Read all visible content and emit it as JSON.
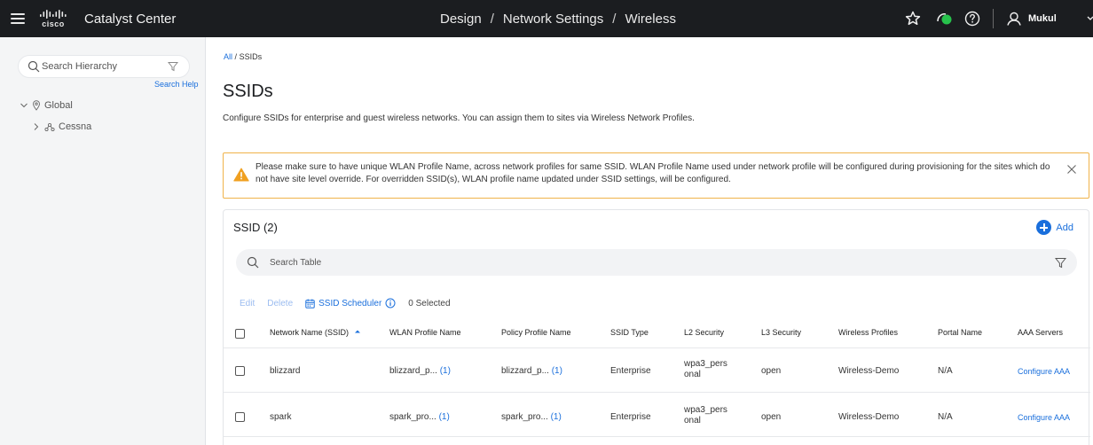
{
  "topbar": {
    "logo_text": "cisco",
    "app_name": "Catalyst Center",
    "breadcrumb": [
      "Design",
      "Network Settings",
      "Wireless"
    ],
    "user_name": "Mukul"
  },
  "sidebar": {
    "search_placeholder": "Search Hierarchy",
    "search_help": "Search Help",
    "tree": [
      {
        "label": "Global"
      },
      {
        "label": "Cessna"
      }
    ]
  },
  "main": {
    "breadcrumb_all": "All",
    "breadcrumb_sep": "/",
    "breadcrumb_current": "SSIDs",
    "title": "SSIDs",
    "description": "Configure SSIDs for enterprise and guest wireless networks. You can assign them to sites via Wireless Network Profiles.",
    "alert_text": "Please make sure to have unique WLAN Profile Name, across network profiles for same SSID. WLAN Profile Name used under network profile will be configured during provisioning for the sites which do not have site level override. For overridden SSID(s), WLAN profile name updated under SSID settings, will be configured."
  },
  "card": {
    "title": "SSID (2)",
    "add_label": "Add",
    "search_placeholder": "Search Table",
    "actions": {
      "edit": "Edit",
      "delete": "Delete",
      "scheduler": "SSID Scheduler",
      "selected": "0 Selected"
    },
    "columns": [
      "Network Name (SSID)",
      "WLAN Profile Name",
      "Policy Profile Name",
      "SSID Type",
      "L2 Security",
      "L3 Security",
      "Wireless Profiles",
      "Portal Name",
      "AAA Servers"
    ],
    "rows": [
      {
        "ssid": "blizzard",
        "wlan_profile": "blizzard_p...",
        "wlan_count": "(1)",
        "policy_profile": "blizzard_p...",
        "policy_count": "(1)",
        "ssid_type": "Enterprise",
        "l2_line1": "wpa3_pers",
        "l2_line2": "onal",
        "l3": "open",
        "wireless_profiles": "Wireless-Demo",
        "portal": "N/A",
        "aaa": "Configure AAA"
      },
      {
        "ssid": "spark",
        "wlan_profile": "spark_pro...",
        "wlan_count": "(1)",
        "policy_profile": "spark_pro...",
        "policy_count": "(1)",
        "ssid_type": "Enterprise",
        "l2_line1": "wpa3_pers",
        "l2_line2": "onal",
        "l3": "open",
        "wireless_profiles": "Wireless-Demo",
        "portal": "N/A",
        "aaa": "Configure AAA"
      }
    ]
  },
  "colors": {
    "topbar_bg": "#1b1d20",
    "link_blue": "#1a6fdc",
    "warning": "#f0a020",
    "health_green": "#27c24c"
  }
}
